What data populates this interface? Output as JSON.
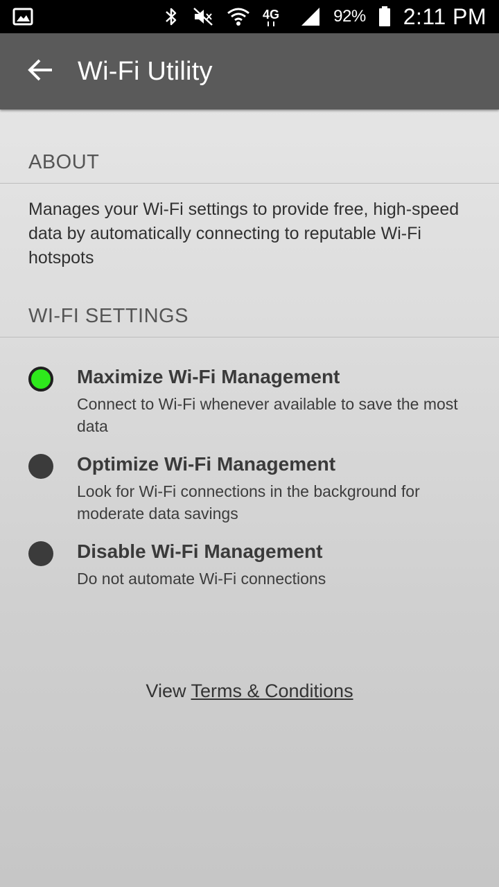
{
  "status_bar": {
    "icons": [
      "gallery-icon",
      "bluetooth-icon",
      "mute-icon",
      "wifi-icon",
      "lte-icon",
      "signal-icon",
      "battery-icon"
    ],
    "network_label": "4G",
    "battery": "92%",
    "time": "2:11 PM"
  },
  "app_bar": {
    "back_icon": "arrow-left-icon",
    "title": "Wi-Fi Utility"
  },
  "about": {
    "header": "ABOUT",
    "text": "Manages your Wi-Fi settings to provide free, high-speed data by automatically connecting to reputable Wi-Fi hotspots"
  },
  "settings": {
    "header": "WI-FI SETTINGS",
    "options": [
      {
        "title": "Maximize Wi-Fi Management",
        "description": "Connect to Wi-Fi whenever available to save the most data",
        "selected": true
      },
      {
        "title": "Optimize Wi-Fi Management",
        "description": "Look for Wi-Fi connections in the background for moderate data savings",
        "selected": false
      },
      {
        "title": "Disable Wi-Fi Management",
        "description": "Do not automate Wi-Fi connections",
        "selected": false
      }
    ]
  },
  "terms": {
    "prefix": "View ",
    "link": "Terms & Conditions"
  },
  "colors": {
    "selected_radio": "#2ee81c",
    "unselected_radio": "#3b3b3b",
    "app_bar": "#5a5a5a",
    "status_bar": "#000000"
  }
}
